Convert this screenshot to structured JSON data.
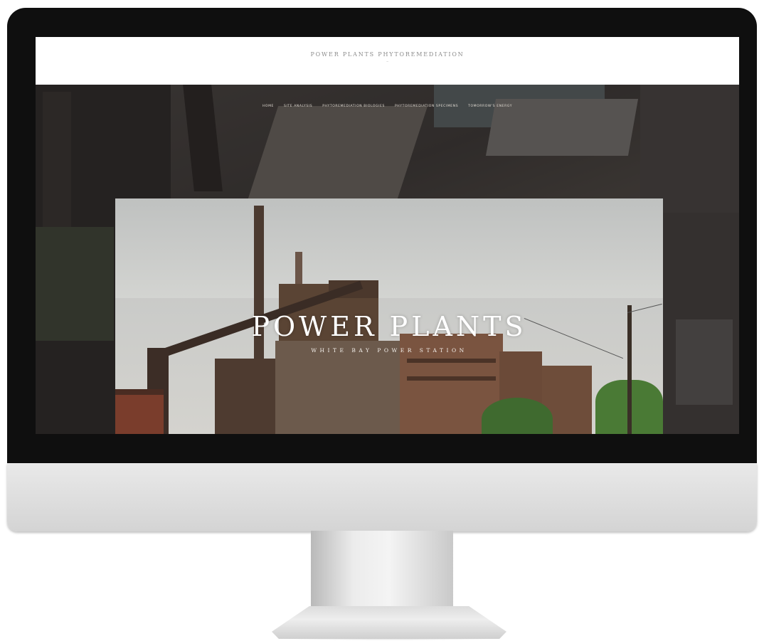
{
  "site": {
    "title": "POWER PLANTS PHYTOREMEDIATION",
    "tagline": "~"
  },
  "nav": {
    "items": [
      {
        "label": "HOME"
      },
      {
        "label": "SITE ANALYSIS"
      },
      {
        "label": "PHYTOREMEDIATION BIOLOGIES"
      },
      {
        "label": "PHYTOREMEDIATION SPECIMENS"
      },
      {
        "label": "TOMORROW'S ENERGY"
      }
    ]
  },
  "hero": {
    "title": "POWER PLANTS",
    "subtitle": "WHITE BAY POWER STATION"
  },
  "colors": {
    "bezel": "#0f0f0f",
    "chin": "#e2e2e2",
    "brick": "#5a3b2c",
    "sky": "#cdcecc",
    "tree": "#3f6a2f"
  }
}
